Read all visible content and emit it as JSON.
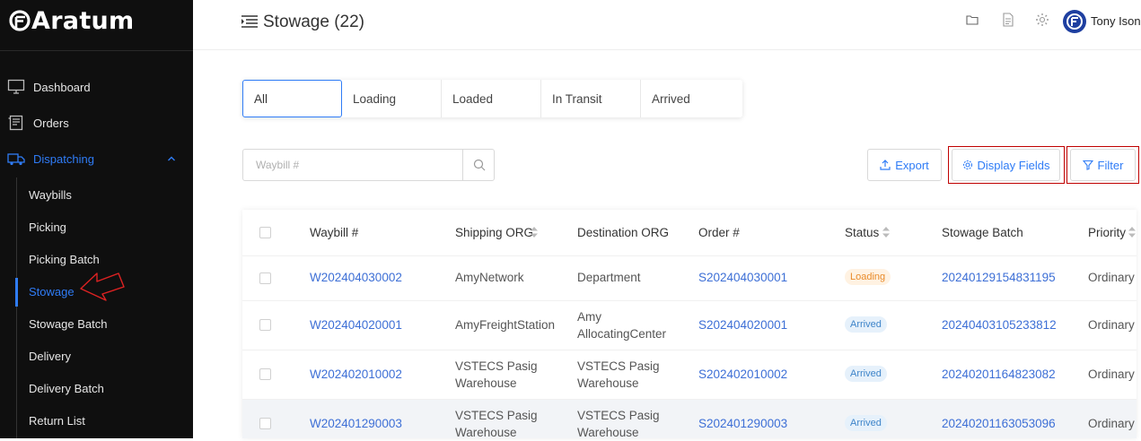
{
  "app": {
    "logo_text": "Aratum"
  },
  "sidebar": {
    "nav": [
      {
        "label": "Dashboard",
        "icon": "monitor-icon"
      },
      {
        "label": "Orders",
        "icon": "orders-icon"
      },
      {
        "label": "Dispatching",
        "icon": "truck-icon",
        "expanded": true
      }
    ],
    "sub_items": [
      "Waybills",
      "Picking",
      "Picking Batch",
      "Stowage",
      "Stowage Batch",
      "Delivery",
      "Delivery Batch",
      "Return List"
    ],
    "active_sub": "Stowage"
  },
  "header": {
    "title": "Stowage (22)",
    "icons": [
      "folder-icon",
      "document-icon",
      "settings-icon"
    ],
    "user_name": "Tony Ison"
  },
  "tabs": [
    "All",
    "Loading",
    "Loaded",
    "In Transit",
    "Arrived"
  ],
  "active_tab": "All",
  "search": {
    "placeholder": "Waybill #",
    "value": ""
  },
  "actions": {
    "export": "Export",
    "display_fields": "Display Fields",
    "filter": "Filter"
  },
  "table": {
    "columns": [
      "Waybill #",
      "Shipping ORG",
      "Destination ORG",
      "Order #",
      "Status",
      "Stowage Batch",
      "Priority"
    ],
    "sortable": [
      "Shipping ORG",
      "Status",
      "Priority"
    ],
    "rows": [
      {
        "waybill": "W202404030002",
        "shipping_l1": "AmyNetwork",
        "shipping_l2": "",
        "dest_l1": "Department",
        "dest_l2": "",
        "order": "S202404030001",
        "status": "Loading",
        "batch": "20240129154831195",
        "priority": "Ordinary"
      },
      {
        "waybill": "W202404020001",
        "shipping_l1": "AmyFreightStation",
        "shipping_l2": "",
        "dest_l1": "Amy",
        "dest_l2": "AllocatingCenter",
        "order": "S202404020001",
        "status": "Arrived",
        "batch": "20240403105233812",
        "priority": "Ordinary"
      },
      {
        "waybill": "W202402010002",
        "shipping_l1": "VSTECS Pasig",
        "shipping_l2": "Warehouse",
        "dest_l1": "VSTECS Pasig",
        "dest_l2": "Warehouse",
        "order": "S202402010002",
        "status": "Arrived",
        "batch": "20240201164823082",
        "priority": "Ordinary"
      },
      {
        "waybill": "W202401290003",
        "shipping_l1": "VSTECS Pasig",
        "shipping_l2": "Warehouse",
        "dest_l1": "VSTECS Pasig",
        "dest_l2": "Warehouse",
        "order": "S202401290003",
        "status": "Arrived",
        "batch": "20240201163053096",
        "priority": "Ordinary"
      }
    ]
  },
  "colors": {
    "accent": "#2f7cf6",
    "sidebar_bg": "#0f0f0f",
    "highlight": "#c00000",
    "loading": "#e98b2a",
    "arrived": "#3d84c9"
  }
}
